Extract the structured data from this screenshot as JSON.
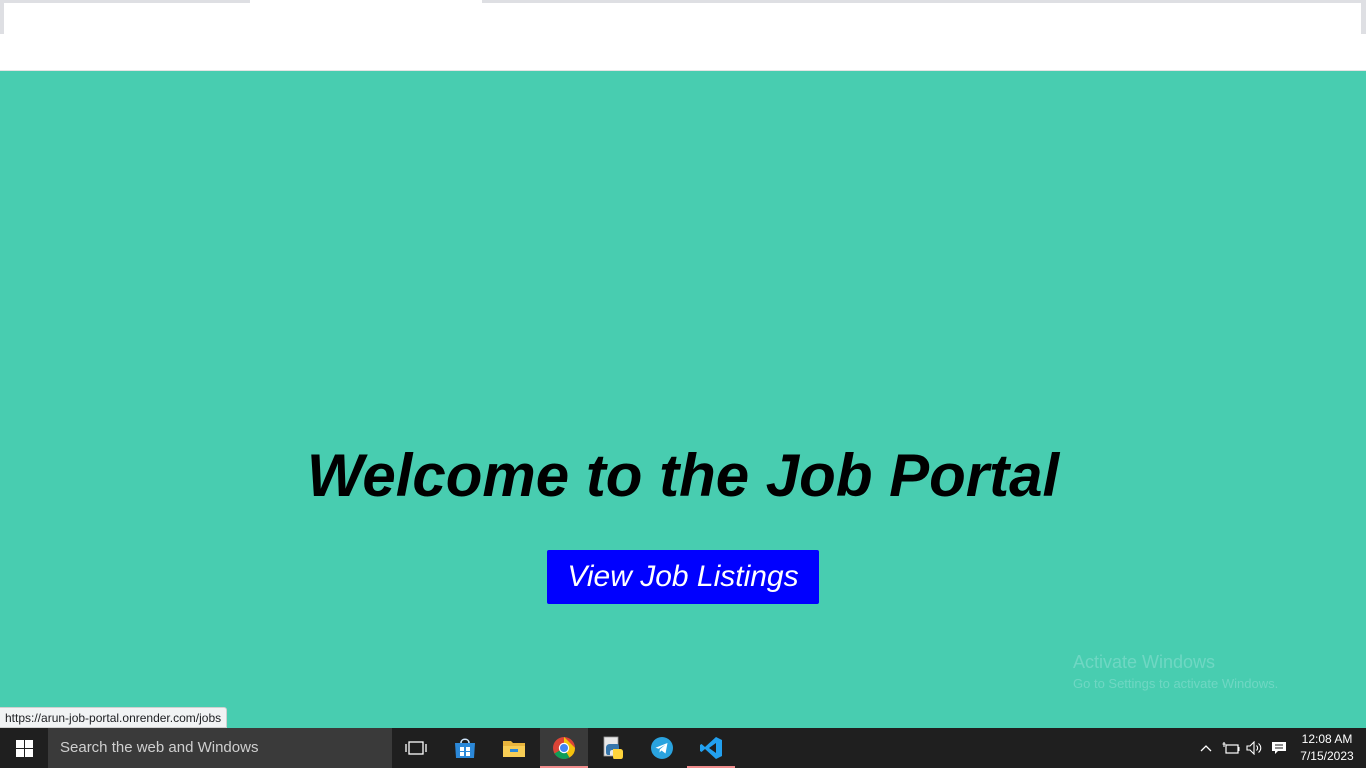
{
  "page": {
    "title": "Welcome to the Job Portal",
    "cta_label": "View Job Listings",
    "background_color": "#48cdb0",
    "button_color": "#0000ff"
  },
  "watermark": {
    "title": "Activate Windows",
    "subtitle": "Go to Settings to activate Windows."
  },
  "status_bar": {
    "url": "https://arun-job-portal.onrender.com/jobs"
  },
  "taskbar": {
    "search_placeholder": "Search the web and Windows",
    "apps": [
      {
        "name": "task-view-icon"
      },
      {
        "name": "store-icon"
      },
      {
        "name": "file-explorer-icon"
      },
      {
        "name": "chrome-icon",
        "active": true
      },
      {
        "name": "python-icon"
      },
      {
        "name": "telegram-icon"
      },
      {
        "name": "vscode-icon"
      }
    ],
    "tray_icons": [
      "chevron-up-icon",
      "battery-icon",
      "volume-icon",
      "notification-icon"
    ],
    "clock": {
      "time": "12:08 AM",
      "date": "7/15/2023"
    }
  }
}
